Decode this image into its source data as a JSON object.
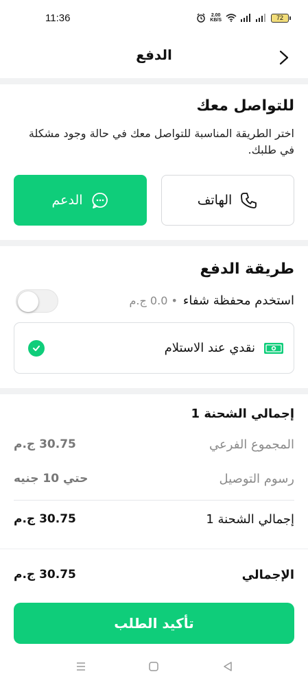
{
  "status_bar": {
    "time": "11:36",
    "speed_value": "2.00",
    "speed_unit": "KB/S",
    "battery": "72"
  },
  "header": {
    "title": "الدفع"
  },
  "contact": {
    "title": "للتواصل معك",
    "description": "اختر الطريقة المناسبة للتواصل معك في حالة وجود مشكلة في طلبك.",
    "phone_label": "الهاتف",
    "support_label": "الدعم"
  },
  "payment": {
    "title": "طريقة الدفع",
    "wallet_label": "استخدم محفظة شفاء",
    "wallet_balance": "• 0.0 ج.م",
    "cod_label": "نقدي عند الاستلام"
  },
  "summary": {
    "title": "إجمالي الشحنة 1",
    "subtotal_label": "المجموع الفرعي",
    "subtotal_value": "30.75 ج.م",
    "delivery_label": "رسوم التوصيل",
    "delivery_value": "حتي 10 جنيه",
    "shipment_total_label": "إجمالي الشحنة 1",
    "shipment_total_value": "30.75 ج.م",
    "grand_total_label": "الإجمالي",
    "grand_total_value": "30.75 ج.م"
  },
  "confirm_button": "تأكيد الطلب",
  "colors": {
    "accent": "#0fcd7a",
    "separator": "#f1f2f3",
    "muted_text": "#8a8a8a"
  }
}
